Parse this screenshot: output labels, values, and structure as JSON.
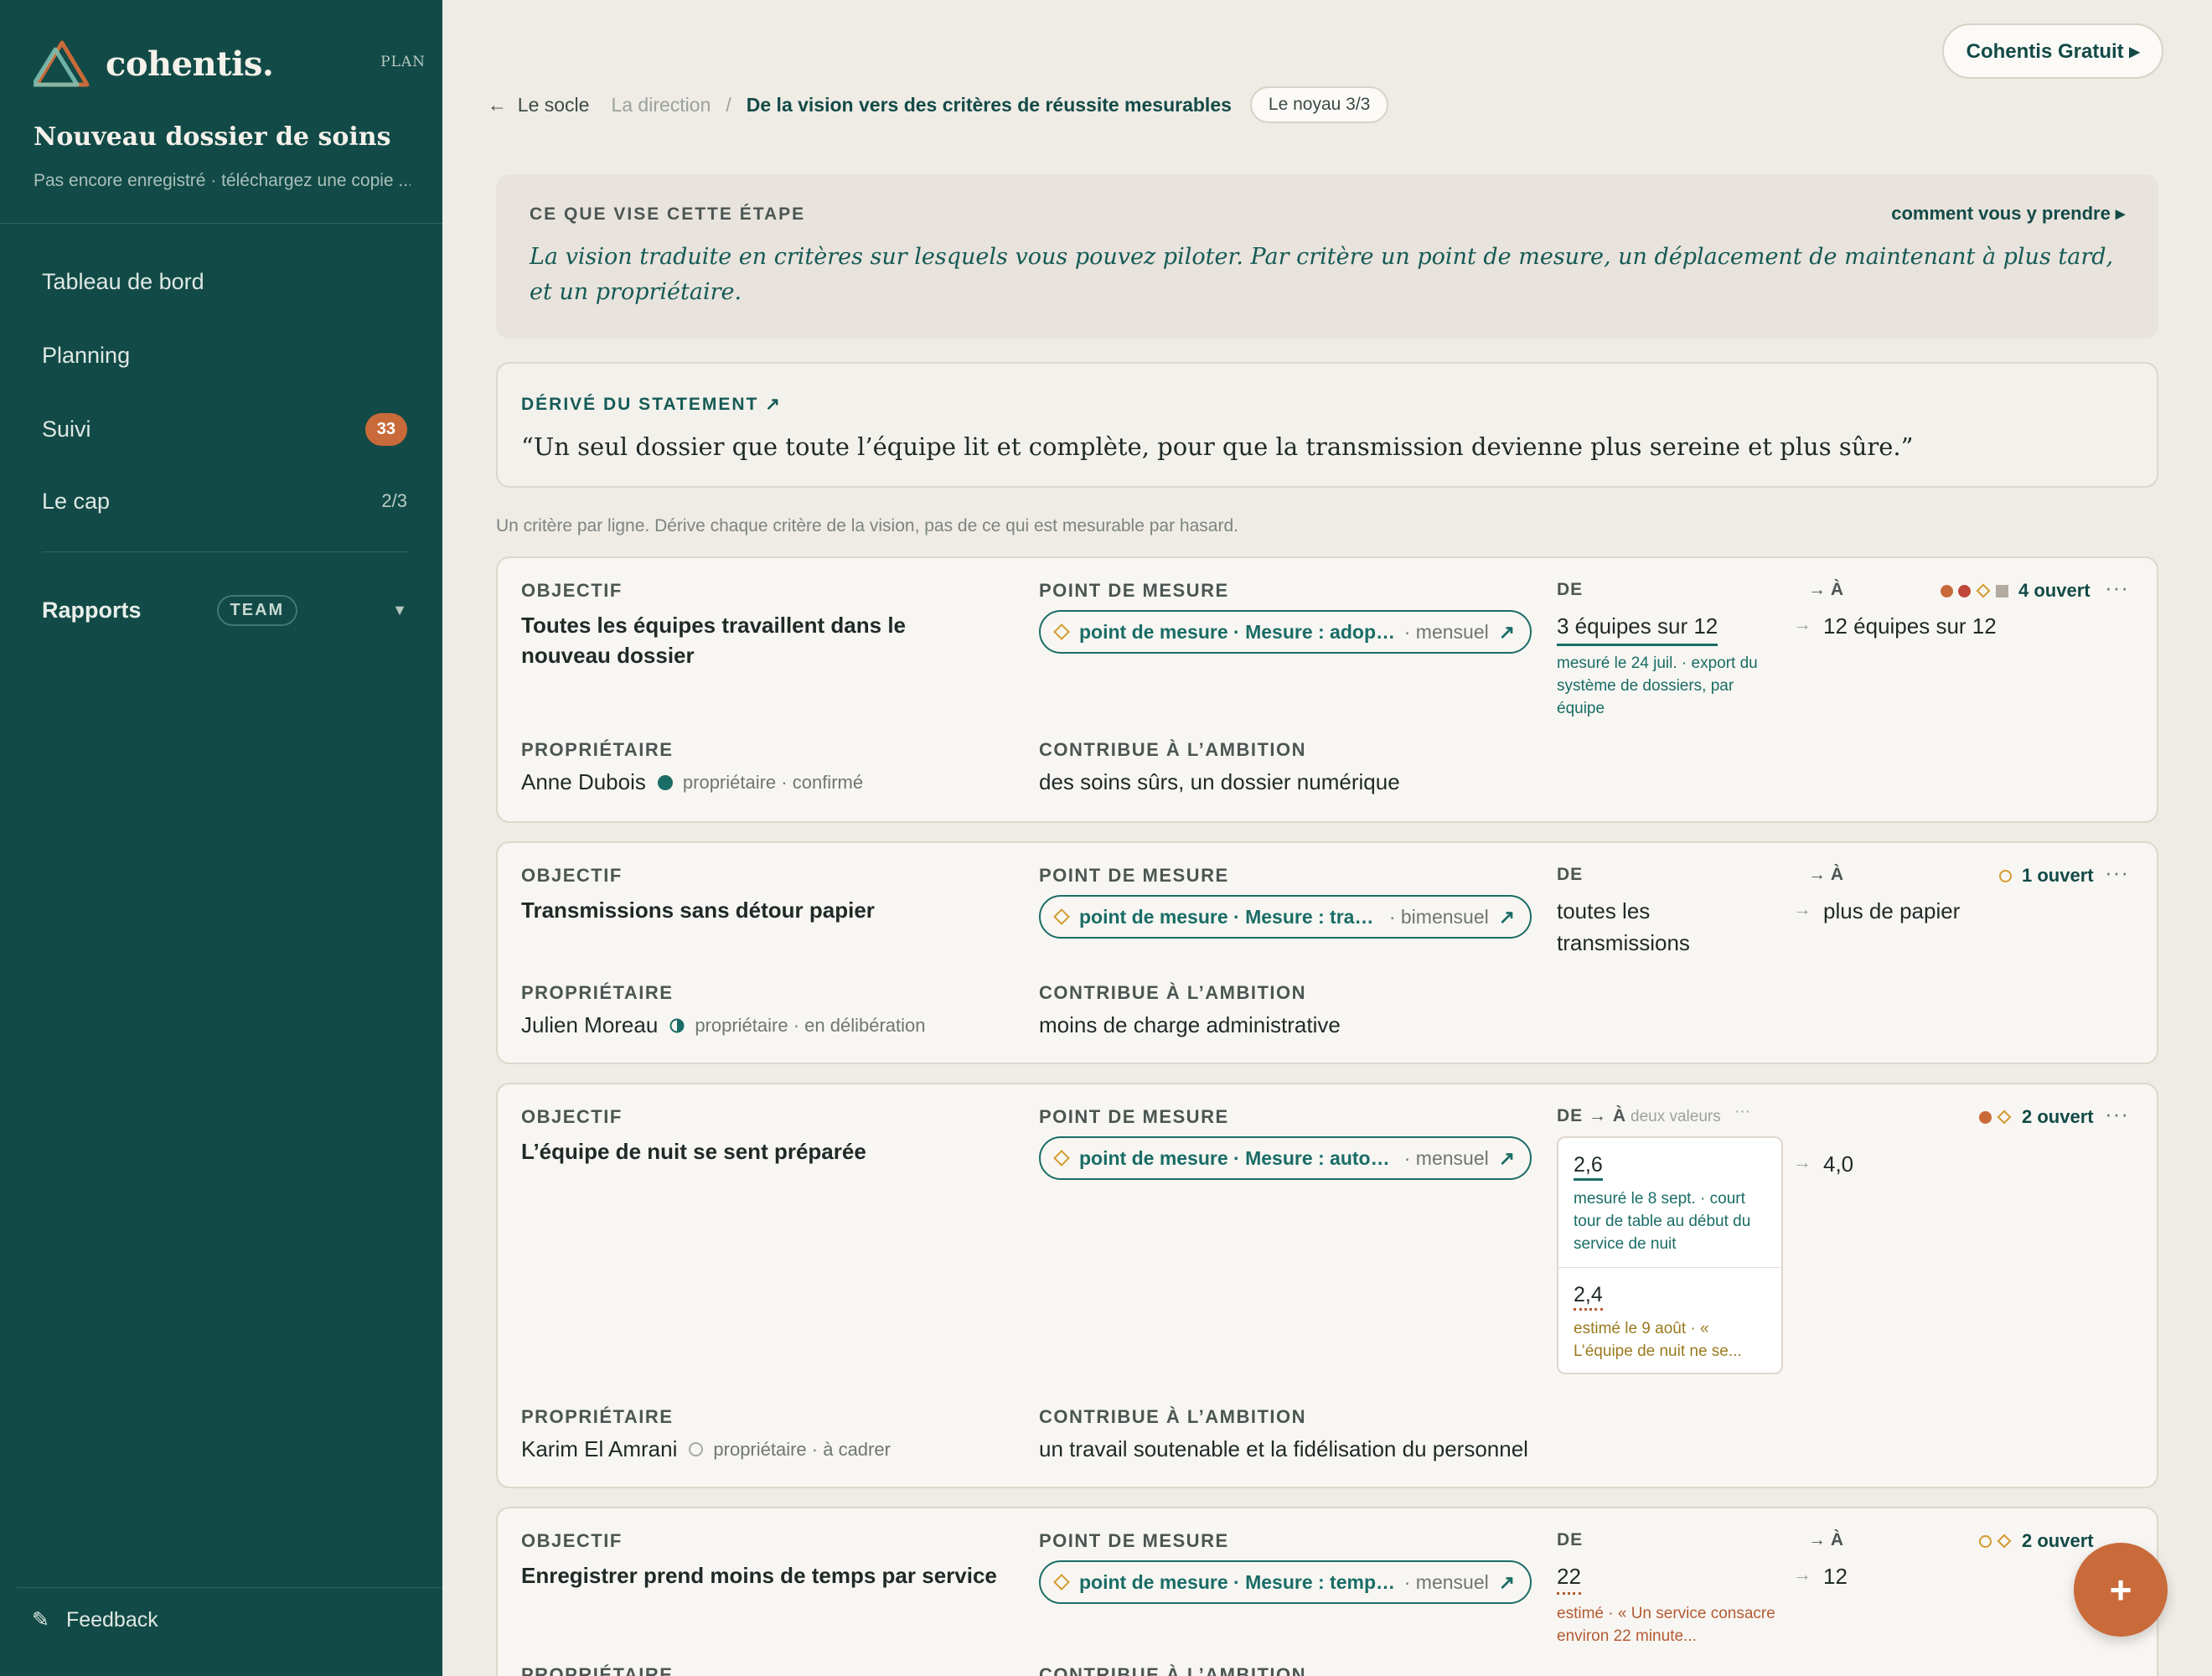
{
  "sidebar": {
    "brand": "cohentis.",
    "plan_tag": "PLAN",
    "dossier_title": "Nouveau dossier de soins",
    "dossier_subtitle": "Pas encore enregistré · téléchargez une copie ...",
    "nav": [
      {
        "label": "Tableau de bord"
      },
      {
        "label": "Planning"
      },
      {
        "label": "Suivi",
        "badge": "33"
      },
      {
        "label": "Le cap",
        "count": "2/3"
      }
    ],
    "reports": {
      "label": "Rapports",
      "tag": "TEAM"
    },
    "feedback": "Feedback"
  },
  "topbar": {
    "plan_button": "Cohentis Gratuit ▸"
  },
  "breadcrumb": {
    "back": "Le socle",
    "middle": "La direction",
    "separator": "/",
    "current": "De la vision vers des critères de réussite mesurables",
    "step": "Le noyau 3/3"
  },
  "intro": {
    "label": "CE QUE VISE CETTE ÉTAPE",
    "link": "comment vous y prendre ▸",
    "text": "La vision traduite en critères sur lesquels vous pouvez piloter. Par critère un point de mesure, un déplacement de maintenant à plus tard, et un propriétaire."
  },
  "statement": {
    "label": "DÉRIVÉ DU STATEMENT ↗",
    "text": "“Un seul dossier que toute l’équipe lit et complète, pour que la transmission devienne plus sereine et plus sûre.”"
  },
  "hint": "Un critère par ligne. Dérive chaque critère de la vision, pas de ce qui est mesurable par hasard.",
  "labels": {
    "objective": "OBJECTIF",
    "measure_point": "POINT DE MESURE",
    "owner": "PROPRIÉTAIRE",
    "ambition": "CONTRIBUE À L’AMBITION",
    "from": "DE",
    "to": "→ À",
    "from_to": "DE → À",
    "two_values": "deux valeurs",
    "arrow": "→",
    "more": "···"
  },
  "criteria": [
    {
      "objective": "Toutes les équipes travaillent dans le nouveau dossier",
      "measure": "point de mesure · Mesure : adoption",
      "frequency": "· mensuel",
      "from": "3 équipes sur 12",
      "from_note": "mesuré le 24 juil. · export du système de dossiers, par équipe",
      "to": "12 équipes sur 12",
      "open": "4 ouvert",
      "owner": "Anne Dubois",
      "owner_status": "propriétaire · confirmé",
      "ambition": "des soins sûrs, un dossier numérique"
    },
    {
      "objective": "Transmissions sans détour papier",
      "measure": "point de mesure · Mesure : transmissions",
      "frequency": "· bimensuel",
      "from": "toutes les transmissions",
      "to": "plus de papier",
      "open": "1 ouvert",
      "owner": "Julien Moreau",
      "owner_status": "propriétaire · en délibération",
      "ambition": "moins de charge administrative"
    },
    {
      "objective": "L’équipe de nuit se sent préparée",
      "measure": "point de mesure · Mesure : auto-évaluation",
      "frequency": "· mensuel",
      "value1": "2,6",
      "value1_note": "mesuré le 8 sept. · court tour de table au début du service de nuit",
      "value2": "2,4",
      "value2_note": "estimé le 9 août · « L’équipe de nuit ne se...",
      "to": "4,0",
      "open": "2 ouvert",
      "owner": "Karim El Amrani",
      "owner_status": "propriétaire · à cadrer",
      "ambition": "un travail soutenable et la fidélisation du personnel"
    },
    {
      "objective": "Enregistrer prend moins de temps par service",
      "measure": "point de mesure · Mesure : temps d’enregistrement",
      "frequency": "· mensuel",
      "from": "22",
      "from_note": "estimé · « Un service consacre environ 22 minute...",
      "to": "12",
      "open": "2 ouvert"
    }
  ],
  "fab": "+",
  "colors": {
    "sidebar": "#124a47",
    "accent": "#c96a3a",
    "teal": "#1a6c66",
    "gold": "#d39b2e",
    "background": "#efebe5"
  }
}
